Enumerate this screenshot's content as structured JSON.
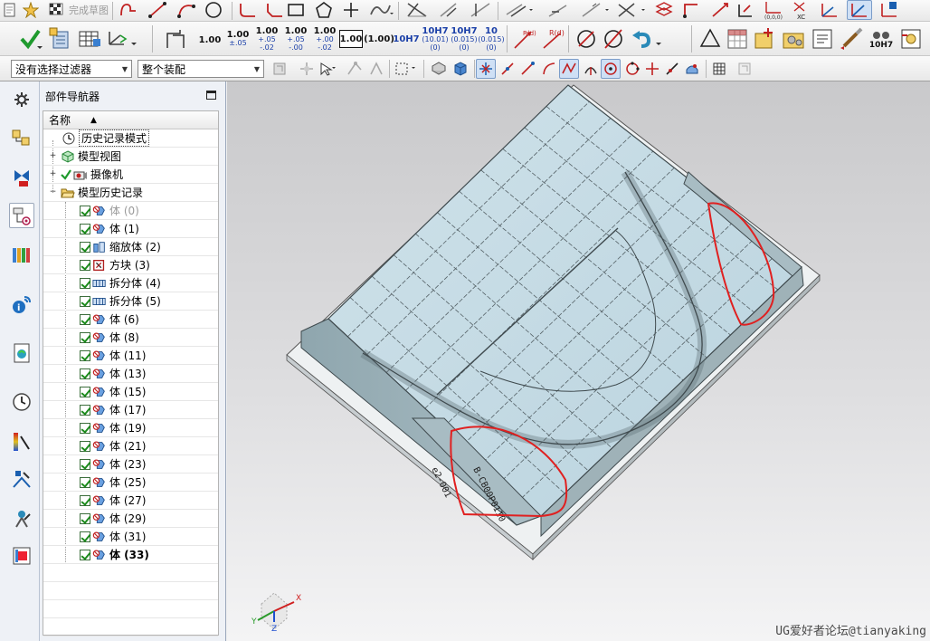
{
  "toolbar_top": {
    "finish_sketch_label": "完成草图"
  },
  "toolbar_main": {
    "tolerances": [
      {
        "main": "1.00",
        "sub1": "",
        "sub2": ""
      },
      {
        "main": "1.00",
        "sub1": "±.05",
        "sub2": ""
      },
      {
        "main": "1.00",
        "sub1": "+.05",
        "sub2": "-.02"
      },
      {
        "main": "1.00",
        "sub1": "+.05",
        "sub2": "-.00"
      },
      {
        "main": "1.00",
        "sub1": "+.00",
        "sub2": "-.02"
      }
    ],
    "boxed_dim": "1.00",
    "paren_dim": "(1.00)",
    "fit_labels": [
      {
        "main": "10H7",
        "sub1": "",
        "sub2": ""
      },
      {
        "main": "10H7",
        "sub1": "(10.01)",
        "sub2": "(0)"
      },
      {
        "main": "10H7",
        "sub1": "(0.015)",
        "sub2": "(0)"
      },
      {
        "main": "10",
        "sub1": "(0.015)",
        "sub2": "(0)"
      }
    ],
    "radius_labels": [
      "R(d)",
      "R(d)"
    ],
    "hole_callout": "10H7"
  },
  "filter_bar": {
    "selection_filter": "没有选择过滤器",
    "assembly_scope": "整个装配"
  },
  "navigator": {
    "title": "部件导航器",
    "column_name": "名称",
    "nodes": [
      {
        "label": "历史记录模式"
      },
      {
        "label": "模型视图"
      },
      {
        "label": "摄像机"
      },
      {
        "label": "模型历史记录"
      }
    ],
    "features": [
      {
        "label": "体 (0)",
        "icon": "body-icon",
        "style": "dim"
      },
      {
        "label": "体 (1)",
        "icon": "body-icon",
        "style": ""
      },
      {
        "label": "缩放体 (2)",
        "icon": "scale-body-icon",
        "style": ""
      },
      {
        "label": "方块 (3)",
        "icon": "block-icon",
        "style": ""
      },
      {
        "label": "拆分体 (4)",
        "icon": "split-body-icon",
        "style": ""
      },
      {
        "label": "拆分体 (5)",
        "icon": "split-body-icon",
        "style": ""
      },
      {
        "label": "体 (6)",
        "icon": "body-icon",
        "style": ""
      },
      {
        "label": "体 (8)",
        "icon": "body-icon",
        "style": ""
      },
      {
        "label": "体 (11)",
        "icon": "body-icon",
        "style": ""
      },
      {
        "label": "体 (13)",
        "icon": "body-icon",
        "style": ""
      },
      {
        "label": "体 (15)",
        "icon": "body-icon",
        "style": ""
      },
      {
        "label": "体 (17)",
        "icon": "body-icon",
        "style": ""
      },
      {
        "label": "体 (19)",
        "icon": "body-icon",
        "style": ""
      },
      {
        "label": "体 (21)",
        "icon": "body-icon",
        "style": ""
      },
      {
        "label": "体 (23)",
        "icon": "body-icon",
        "style": ""
      },
      {
        "label": "体 (25)",
        "icon": "body-icon",
        "style": ""
      },
      {
        "label": "体 (27)",
        "icon": "body-icon",
        "style": ""
      },
      {
        "label": "体 (29)",
        "icon": "body-icon",
        "style": ""
      },
      {
        "label": "体 (31)",
        "icon": "body-icon",
        "style": ""
      },
      {
        "label": "体 (33)",
        "icon": "body-icon",
        "style": "bold"
      }
    ]
  },
  "viewport": {
    "part_engraving_1": "e2-001",
    "part_engraving_2": "B-CB00P0110",
    "watermark": "UG爱好者论坛@tianyaking",
    "triad_x": "X",
    "triad_y": "Y",
    "triad_z": "Z",
    "highlight_color": "#e02020"
  }
}
